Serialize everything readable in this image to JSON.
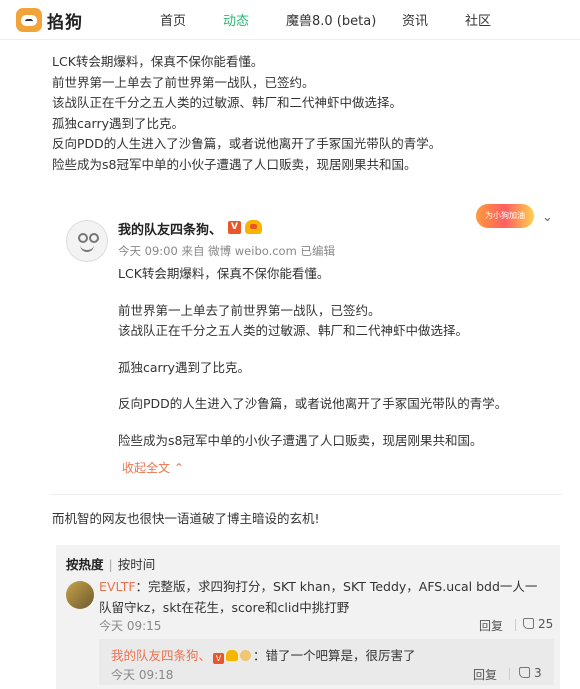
{
  "nav": {
    "logo_text": "掐狗",
    "items": [
      {
        "label": "首页"
      },
      {
        "label": "动态"
      },
      {
        "label": "魔兽8.0 (beta)"
      },
      {
        "label": "资讯"
      },
      {
        "label": "社区"
      }
    ]
  },
  "intro": {
    "lines": [
      "LCK转会期爆料，保真不保你能看懂。",
      "前世界第一上单去了前世界第一战队，已签约。",
      "该战队正在千分之五人类的过敏源、韩厂和二代神虾中做选择。",
      "孤独carry遇到了比克。",
      "反向PDD的人生进入了沙鲁篇，或者说他离开了手冢国光带队的青学。",
      "险些成为s8冠军中单的小伙子遭遇了人口贩卖，现居刚果共和国。"
    ]
  },
  "card": {
    "author": "我的队友四条狗、",
    "v_badge": "V",
    "promo": "为小狗加油",
    "chevron": "⌄",
    "meta": "今天 09:00 来自 微博 weibo.com  已编辑",
    "lines": [
      "LCK转会期爆料，保真不保你能看懂。",
      "前世界第一上单去了前世界第一战队，已签约。",
      "该战队正在千分之五人类的过敏源、韩厂和二代神虾中做选择。",
      "孤独carry遇到了比克。",
      "反向PDD的人生进入了沙鲁篇，或者说他离开了手冢国光带队的青学。",
      "险些成为s8冠军中单的小伙子遭遇了人口贩卖，现居刚果共和国。"
    ],
    "collapse": "收起全文 ⌃"
  },
  "commentary": "而机智的网友也很快一语道破了博主暗设的玄机!",
  "comments": {
    "sort_hot": "按热度",
    "sort_sep": "|",
    "sort_time": "按时间",
    "main": {
      "author": "EVLTF",
      "text_line1": "：完整版，求四狗打分，SKT khan，SKT Teddy，AFS.ucal bdd一人一",
      "text_line2": "队留守kz，skt在花生，score和clid中挑打野",
      "time": "今天 09:15",
      "reply": "回复",
      "likes": "25"
    },
    "sub": {
      "author": "我的队友四条狗、",
      "v_badge": "V",
      "text": "：错了一个吧算是，很厉害了",
      "time": "今天 09:18",
      "reply": "回复",
      "likes": "3"
    }
  }
}
